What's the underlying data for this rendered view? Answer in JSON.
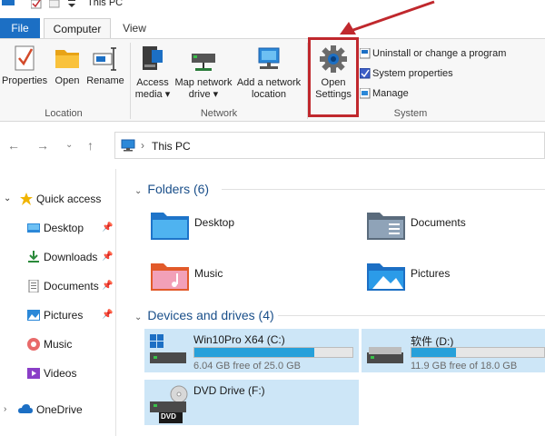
{
  "window": {
    "title": "This PC"
  },
  "ribbon_tabs": {
    "file": "File",
    "computer": "Computer",
    "view": "View"
  },
  "ribbon": {
    "location": {
      "label": "Location",
      "properties": "Properties",
      "open": "Open",
      "rename": "Rename"
    },
    "network": {
      "label": "Network",
      "access_media_line1": "Access",
      "access_media_line2": "media ▾",
      "map_drive_line1": "Map network",
      "map_drive_line2": "drive ▾",
      "add_location_line1": "Add a network",
      "add_location_line2": "location"
    },
    "system": {
      "label": "System",
      "open_settings_line1": "Open",
      "open_settings_line2": "Settings",
      "uninstall": "Uninstall or change a program",
      "system_properties": "System properties",
      "manage": "Manage"
    }
  },
  "address": {
    "path": "This PC"
  },
  "sidebar": {
    "quick_access": "Quick access",
    "items": [
      {
        "label": "Desktop",
        "pinned": true
      },
      {
        "label": "Downloads",
        "pinned": true
      },
      {
        "label": "Documents",
        "pinned": true
      },
      {
        "label": "Pictures",
        "pinned": true
      },
      {
        "label": "Music",
        "pinned": false
      },
      {
        "label": "Videos",
        "pinned": false
      }
    ],
    "onedrive": "OneDrive"
  },
  "content": {
    "folders_header": "Folders (6)",
    "folders": [
      "Desktop",
      "Documents",
      "Music",
      "Pictures"
    ],
    "devices_header": "Devices and drives (4)",
    "drives": [
      {
        "name": "Win10Pro X64 (C:)",
        "free_text": "6.04 GB free of 25.0 GB",
        "used_fraction": 0.758
      },
      {
        "name": "软件 (D:)",
        "free_text": "11.9 GB free of 18.0 GB",
        "used_fraction": 0.339
      },
      {
        "name": "DVD Drive (F:)",
        "badge": "DVD"
      }
    ]
  },
  "colors": {
    "accent": "#1c6fc4",
    "highlight": "#c0282d",
    "selection": "#cde6f7",
    "drive_fill": "#26a0da"
  }
}
